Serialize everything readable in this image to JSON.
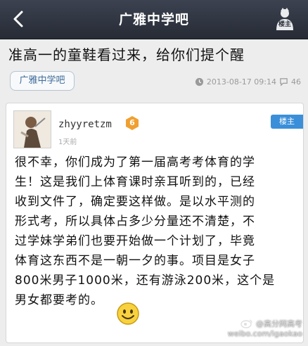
{
  "header": {
    "title": "广雅中学吧",
    "owner_button_label": "楼主"
  },
  "post": {
    "title": "准高一的童鞋看过来，给你们提个醒",
    "forum_tag": "广雅中学吧",
    "datetime": "2013-08-17 09:14",
    "reply_count": "46"
  },
  "floor": {
    "username": "zhyyretzm",
    "level": "6",
    "time_ago": "1天前",
    "owner_tag": "楼主",
    "lines": [
      "很不幸，你们成为了第一届高考考体育的学",
      "生！这是我们上体育课时亲耳听到的，已经",
      "收到文件了，确定要这样做。是以水平测的",
      "形式考，所以具体占多少分量还不清楚，不",
      "过学妹学弟们也要开始做一个计划了，毕竟",
      "体育这东西不是一朝一夕的事。项目是女子",
      "800米男子1000米，还有游泳200米，这个是",
      "男女都要考的。"
    ],
    "emoji_icon": "smiley-icon"
  },
  "watermark": {
    "account": "@高分网高考",
    "url": "weibo.com/igaokao"
  },
  "icons": {
    "back": "back-arrow-icon",
    "owner": "owner-icon",
    "clock": "clock-icon",
    "comments": "comment-icon",
    "level": "level-badge-icon",
    "weibo": "weibo-icon"
  },
  "colors": {
    "topbar": "#2f3440",
    "accent_blue": "#3b8fd9",
    "level_orange": "#f0a030",
    "tag_text": "#3f6b99"
  }
}
